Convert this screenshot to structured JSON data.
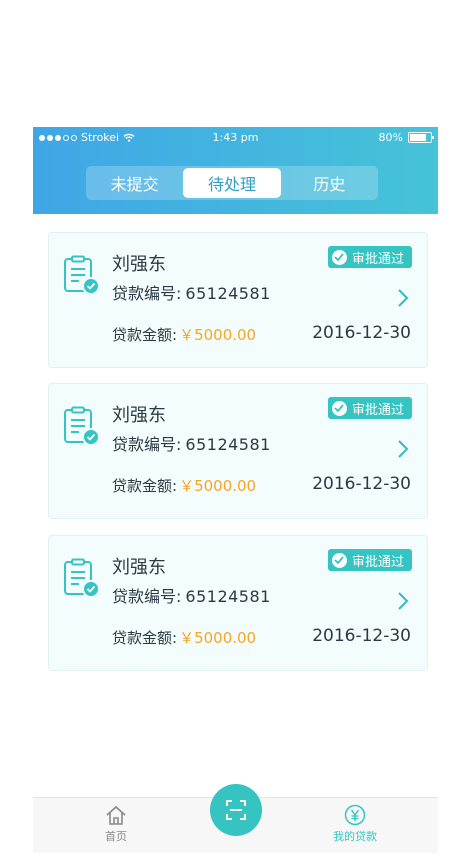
{
  "status_bar": {
    "carrier": "Strokei",
    "time": "1:43 pm",
    "battery": "80%"
  },
  "tabs": [
    {
      "label": "未提交",
      "active": false
    },
    {
      "label": "待处理",
      "active": true
    },
    {
      "label": "历史",
      "active": false
    }
  ],
  "cards": [
    {
      "name": "刘强东",
      "status": "审批通过",
      "loan_no_label": "贷款编号:",
      "loan_no": "65124581",
      "amount_label": "贷款金额:",
      "amount": "￥5000.00",
      "date": "2016-12-30"
    },
    {
      "name": "刘强东",
      "status": "审批通过",
      "loan_no_label": "贷款编号:",
      "loan_no": "65124581",
      "amount_label": "贷款金额:",
      "amount": "￥5000.00",
      "date": "2016-12-30"
    },
    {
      "name": "刘强东",
      "status": "审批通过",
      "loan_no_label": "贷款编号:",
      "loan_no": "65124581",
      "amount_label": "贷款金额:",
      "amount": "￥5000.00",
      "date": "2016-12-30"
    }
  ],
  "tab_bar": {
    "home_label": "首页",
    "my_loans_label": "我的贷款",
    "scan_icon": "scan-icon"
  },
  "colors": {
    "accent": "#35c4c1",
    "header_start": "#3fa6e6",
    "header_end": "#46c3d8",
    "amount": "#f7a623"
  }
}
